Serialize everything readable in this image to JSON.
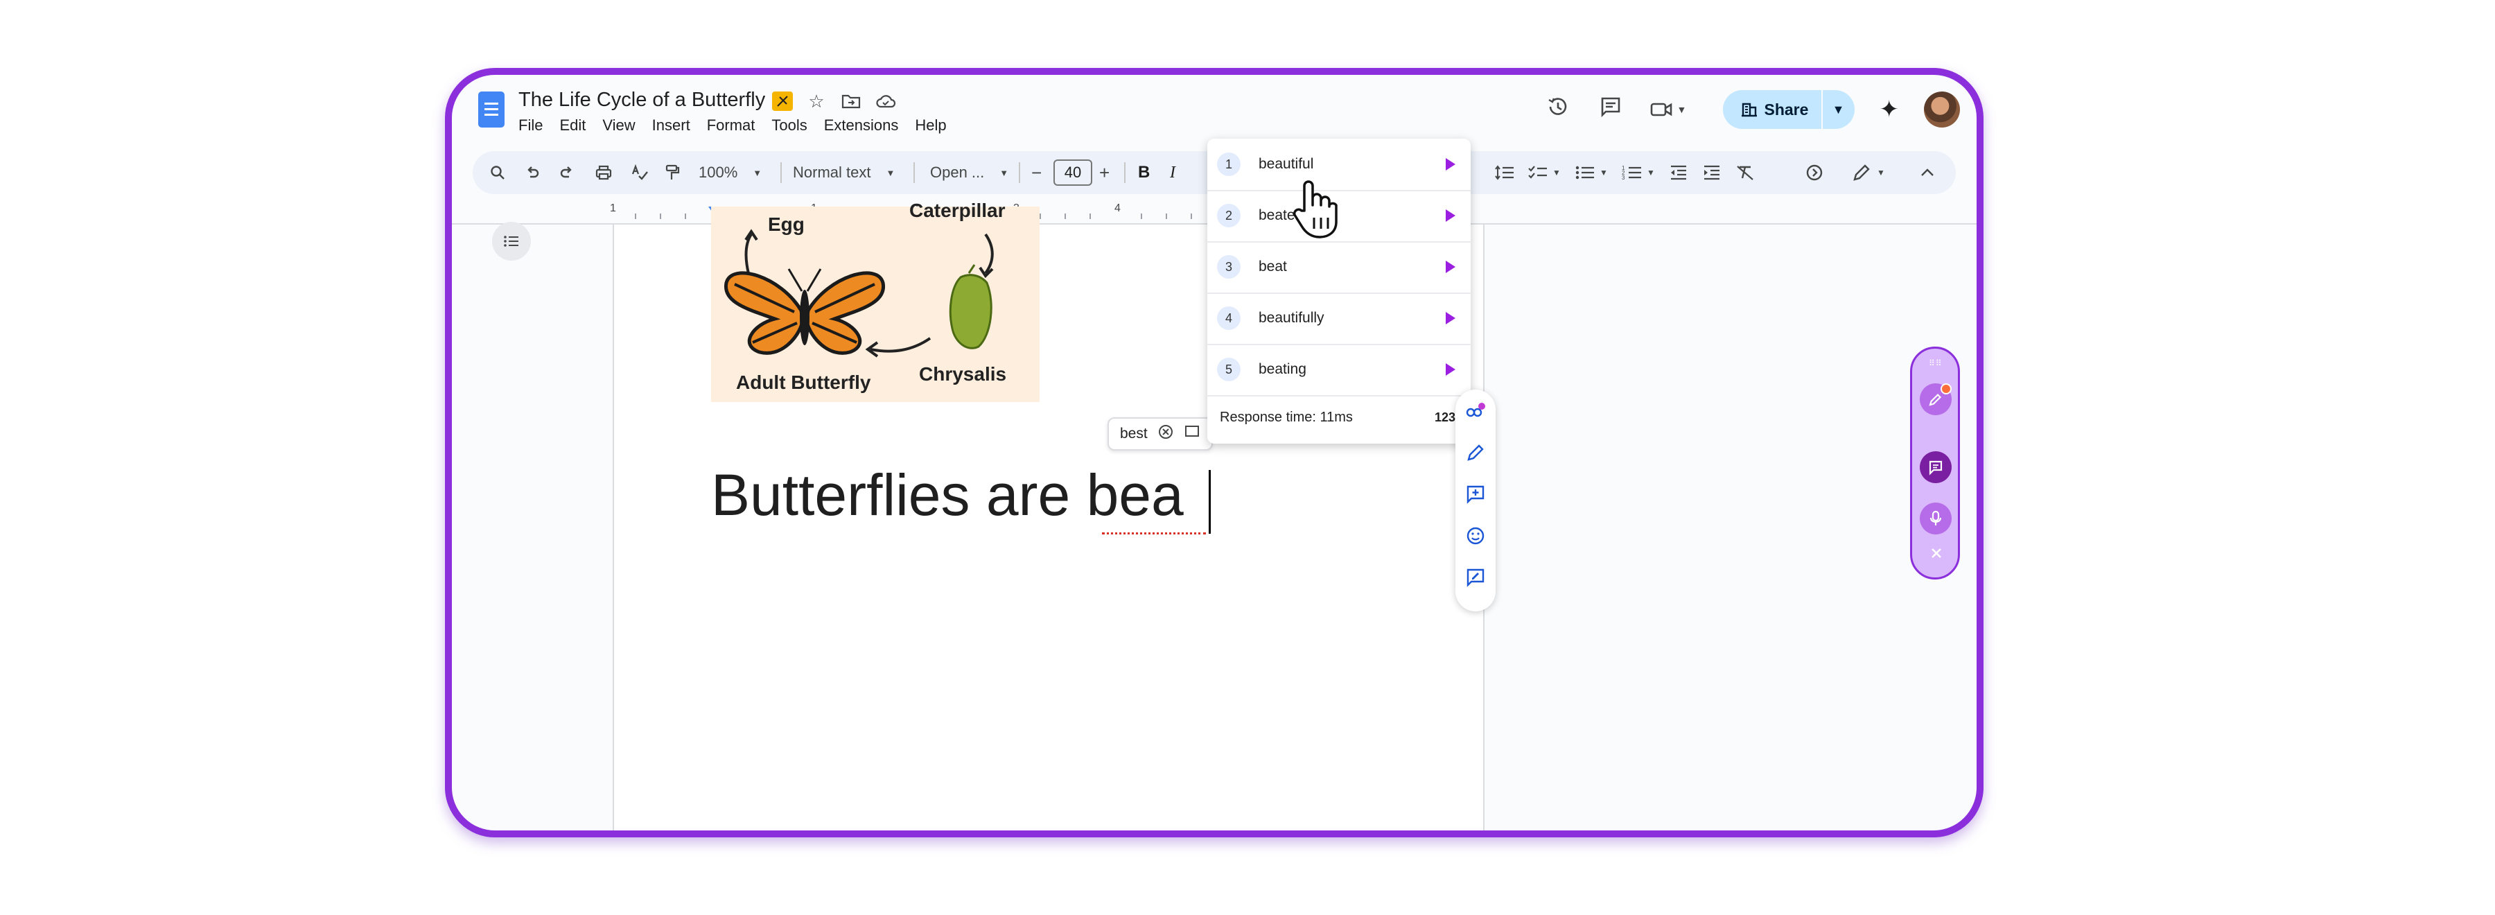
{
  "document": {
    "title": "The Life Cycle of a Butterfly",
    "menus": [
      "File",
      "Edit",
      "View",
      "Insert",
      "Format",
      "Tools",
      "Extensions",
      "Help"
    ]
  },
  "header": {
    "share_label": "Share"
  },
  "toolbar": {
    "zoom": "100%",
    "style": "Normal text",
    "font": "Open ...",
    "font_size": "40",
    "minus": "−",
    "plus": "+",
    "bold": "B",
    "italic": "I"
  },
  "ruler": {
    "labels": [
      "1",
      "1",
      "2",
      "3",
      "4"
    ]
  },
  "diagram": {
    "labels": {
      "egg": "Egg",
      "caterpillar": "Caterpillar",
      "adult": "Adult Butterfly",
      "chrysalis": "Chrysalis"
    }
  },
  "body": {
    "text": "Butterflies are bea"
  },
  "spell_chip": {
    "suggestion": "best"
  },
  "suggestions": {
    "items": [
      {
        "num": "1",
        "word": "beautiful"
      },
      {
        "num": "2",
        "word": "beaten"
      },
      {
        "num": "3",
        "word": "beat"
      },
      {
        "num": "4",
        "word": "beautifully"
      },
      {
        "num": "5",
        "word": "beating"
      }
    ],
    "response_time": "Response time: 11ms",
    "mode": "123"
  },
  "colors": {
    "frame": "#8b2fdd",
    "accent": "#9b1fe0",
    "docs_blue": "#4285f4",
    "share_bg": "#c2e7ff"
  }
}
